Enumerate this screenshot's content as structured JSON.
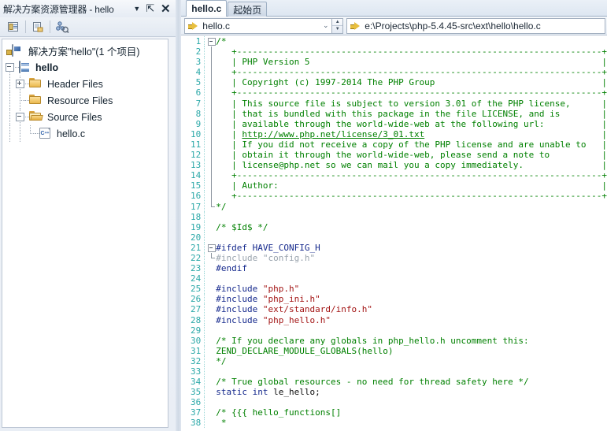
{
  "solution_explorer": {
    "title": "解决方案资源管理器 - hello",
    "titlebar_buttons": [
      {
        "name": "dropdown-menu-button",
        "glyph": "▼"
      },
      {
        "name": "pin-button",
        "glyph": "⇱"
      },
      {
        "name": "close-button",
        "glyph": "✕"
      }
    ],
    "toolbar": [
      {
        "name": "properties-window-icon",
        "tooltip": "属性窗口"
      },
      {
        "name": "show-all-files-icon",
        "tooltip": "显示所有文件"
      },
      {
        "name": "class-view-icon",
        "tooltip": "类视图"
      }
    ],
    "tree": [
      {
        "label": "解决方案\"hello\"(1 个项目)",
        "icon": "solution-icon",
        "depth": 0,
        "bold": false,
        "expander": "none"
      },
      {
        "label": "hello",
        "icon": "project-icon",
        "depth": 1,
        "bold": true,
        "expander": "minus"
      },
      {
        "label": "Header Files",
        "icon": "folder-icon",
        "depth": 2,
        "bold": false,
        "expander": "plus"
      },
      {
        "label": "Resource Files",
        "icon": "folder-icon",
        "depth": 2,
        "bold": false,
        "expander": "none"
      },
      {
        "label": "Source Files",
        "icon": "folder-open-icon",
        "depth": 2,
        "bold": false,
        "expander": "minus"
      },
      {
        "label": "hello.c",
        "icon": "cpp-file-icon",
        "depth": 3,
        "bold": false,
        "expander": "none"
      }
    ]
  },
  "editor": {
    "tabs": [
      {
        "label": "hello.c",
        "active": true
      },
      {
        "label": "起始页",
        "active": false
      }
    ],
    "navbar": {
      "member_combo_value": "hello.c",
      "path_value": "e:\\Projects\\php-5.4.45-src\\ext\\hello\\hello.c",
      "chevron_glyph": "⌄",
      "spinner_up": "▲",
      "spinner_down": "▼"
    },
    "colors": {
      "comment": "#008000",
      "preprocessor": "#14288c",
      "string": "#a31515",
      "plain": "#0d0d0d",
      "line_number": "#2ba8a8",
      "inactive_code": "#9aa4ae"
    },
    "code_lines": [
      {
        "n": 1,
        "fold": "minus",
        "segments": [
          {
            "t": "/*",
            "c": "cmt"
          }
        ]
      },
      {
        "n": 2,
        "fold": "vbar",
        "segments": [
          {
            "t": "   +----------------------------------------------------------------------+",
            "c": "cmt"
          }
        ]
      },
      {
        "n": 3,
        "fold": "vbar",
        "segments": [
          {
            "t": "   | PHP Version 5                                                        |",
            "c": "cmt"
          }
        ]
      },
      {
        "n": 4,
        "fold": "vbar",
        "segments": [
          {
            "t": "   +----------------------------------------------------------------------+",
            "c": "cmt"
          }
        ]
      },
      {
        "n": 5,
        "fold": "vbar",
        "segments": [
          {
            "t": "   | Copyright (c) 1997-2014 The PHP Group                                |",
            "c": "cmt"
          }
        ]
      },
      {
        "n": 6,
        "fold": "vbar",
        "segments": [
          {
            "t": "   +----------------------------------------------------------------------+",
            "c": "cmt"
          }
        ]
      },
      {
        "n": 7,
        "fold": "vbar",
        "segments": [
          {
            "t": "   | This source file is subject to version 3.01 of the PHP license,      |",
            "c": "cmt"
          }
        ]
      },
      {
        "n": 8,
        "fold": "vbar",
        "segments": [
          {
            "t": "   | that is bundled with this package in the file LICENSE, and is        |",
            "c": "cmt"
          }
        ]
      },
      {
        "n": 9,
        "fold": "vbar",
        "segments": [
          {
            "t": "   | available through the world-wide-web at the following url:           |",
            "c": "cmt"
          }
        ]
      },
      {
        "n": 10,
        "fold": "vbar",
        "segments": [
          {
            "t": "   | ",
            "c": "cmt"
          },
          {
            "t": "http://www.php.net/license/3_01.txt",
            "c": "lnk"
          },
          {
            "t": "                                  |",
            "c": "cmt"
          }
        ]
      },
      {
        "n": 11,
        "fold": "vbar",
        "segments": [
          {
            "t": "   | If you did not receive a copy of the PHP license and are unable to   |",
            "c": "cmt"
          }
        ]
      },
      {
        "n": 12,
        "fold": "vbar",
        "segments": [
          {
            "t": "   | obtain it through the world-wide-web, please send a note to          |",
            "c": "cmt"
          }
        ]
      },
      {
        "n": 13,
        "fold": "vbar",
        "segments": [
          {
            "t": "   | license@php.net so we can mail you a copy immediately.               |",
            "c": "cmt"
          }
        ]
      },
      {
        "n": 14,
        "fold": "vbar",
        "segments": [
          {
            "t": "   +----------------------------------------------------------------------+",
            "c": "cmt"
          }
        ]
      },
      {
        "n": 15,
        "fold": "vbar",
        "segments": [
          {
            "t": "   | Author:                                                              |",
            "c": "cmt"
          }
        ]
      },
      {
        "n": 16,
        "fold": "vbar",
        "segments": [
          {
            "t": "   +----------------------------------------------------------------------+",
            "c": "cmt"
          }
        ]
      },
      {
        "n": 17,
        "fold": "endbar",
        "segments": [
          {
            "t": "*/",
            "c": "cmt"
          }
        ]
      },
      {
        "n": 18,
        "fold": "none",
        "segments": []
      },
      {
        "n": 19,
        "fold": "none",
        "segments": [
          {
            "t": "/* $Id$ */",
            "c": "cmt"
          }
        ]
      },
      {
        "n": 20,
        "fold": "none",
        "segments": []
      },
      {
        "n": 21,
        "fold": "minus",
        "segments": [
          {
            "t": "#ifdef HAVE_CONFIG_H",
            "c": "pre"
          }
        ]
      },
      {
        "n": 22,
        "fold": "endbar",
        "segments": [
          {
            "t": "#include \"config.h\"",
            "c": "gray"
          }
        ]
      },
      {
        "n": 23,
        "fold": "none",
        "segments": [
          {
            "t": "#endif",
            "c": "pre"
          }
        ]
      },
      {
        "n": 24,
        "fold": "none",
        "segments": []
      },
      {
        "n": 25,
        "fold": "none",
        "segments": [
          {
            "t": "#include ",
            "c": "pre"
          },
          {
            "t": "\"php.h\"",
            "c": "str"
          }
        ]
      },
      {
        "n": 26,
        "fold": "none",
        "segments": [
          {
            "t": "#include ",
            "c": "pre"
          },
          {
            "t": "\"php_ini.h\"",
            "c": "str"
          }
        ]
      },
      {
        "n": 27,
        "fold": "none",
        "segments": [
          {
            "t": "#include ",
            "c": "pre"
          },
          {
            "t": "\"ext/standard/info.h\"",
            "c": "str"
          }
        ]
      },
      {
        "n": 28,
        "fold": "none",
        "segments": [
          {
            "t": "#include ",
            "c": "pre"
          },
          {
            "t": "\"php_hello.h\"",
            "c": "str"
          }
        ]
      },
      {
        "n": 29,
        "fold": "none",
        "segments": []
      },
      {
        "n": 30,
        "fold": "none",
        "segments": [
          {
            "t": "/* If you declare any globals in php_hello.h uncomment this:",
            "c": "cmt"
          }
        ]
      },
      {
        "n": 31,
        "fold": "none",
        "segments": [
          {
            "t": "ZEND_DECLARE_MODULE_GLOBALS(hello)",
            "c": "cmt"
          }
        ]
      },
      {
        "n": 32,
        "fold": "none",
        "segments": [
          {
            "t": "*/",
            "c": "cmt"
          }
        ]
      },
      {
        "n": 33,
        "fold": "none",
        "segments": []
      },
      {
        "n": 34,
        "fold": "none",
        "segments": [
          {
            "t": "/* True global resources - no need for thread safety here */",
            "c": "cmt"
          }
        ]
      },
      {
        "n": 35,
        "fold": "none",
        "segments": [
          {
            "t": "static int",
            "c": "kw"
          },
          {
            "t": " le_hello;",
            "c": "plain"
          }
        ]
      },
      {
        "n": 36,
        "fold": "none",
        "segments": []
      },
      {
        "n": 37,
        "fold": "none",
        "segments": [
          {
            "t": "/* {{{ hello_functions[]",
            "c": "cmt"
          }
        ]
      },
      {
        "n": 38,
        "fold": "none",
        "segments": [
          {
            "t": " *",
            "c": "cmt"
          }
        ]
      }
    ]
  }
}
